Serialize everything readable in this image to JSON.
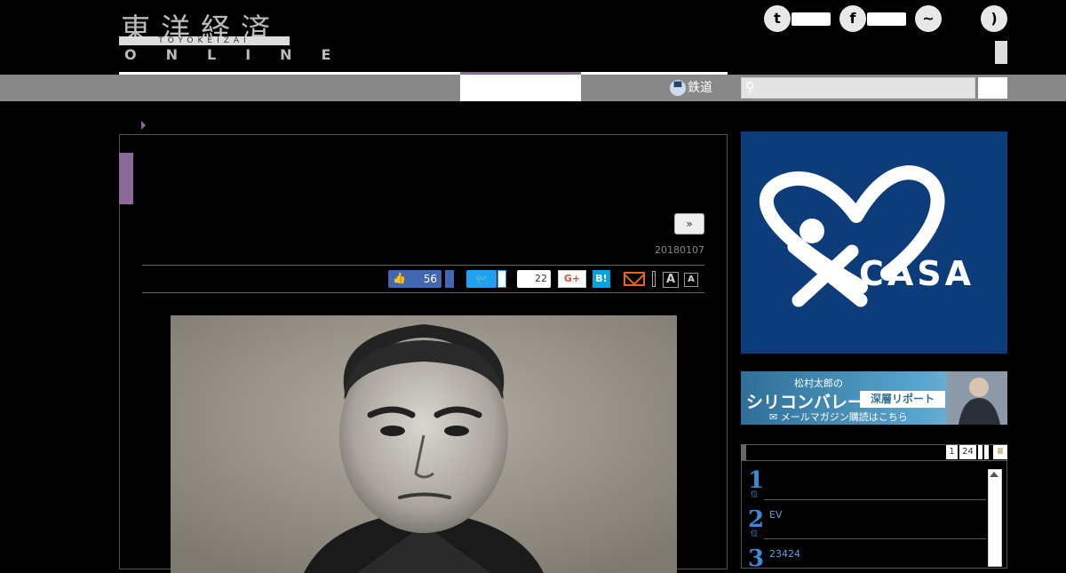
{
  "header": {
    "logo_kanji": "東洋経済",
    "logo_romaji": "TOYOKEIZAI",
    "logo_online": "ONLINE"
  },
  "nav": {
    "rail_label": "鉄道"
  },
  "article": {
    "next_label": "»",
    "date": "20180107",
    "like_count": "56",
    "pocket_count": "22",
    "gplus_label": "G+",
    "hatena_label": "B!",
    "font_large": "A",
    "font_small": "A"
  },
  "ads": {
    "casa_text": "CASA",
    "banner_line1": "松村太郎の",
    "banner_line2": "シリコンバレー",
    "banner_tag": "深層リポート",
    "banner_line3": "✉ メールマガジン購読はこちら"
  },
  "ranking": {
    "tabs": [
      "1",
      "24",
      "",
      "",
      "Ⅲ"
    ],
    "items": [
      {
        "rank": "1",
        "sub": "位",
        "text": ""
      },
      {
        "rank": "2",
        "sub": "位",
        "text": "EV"
      },
      {
        "rank": "3",
        "sub": "位",
        "text": "23424"
      }
    ]
  }
}
